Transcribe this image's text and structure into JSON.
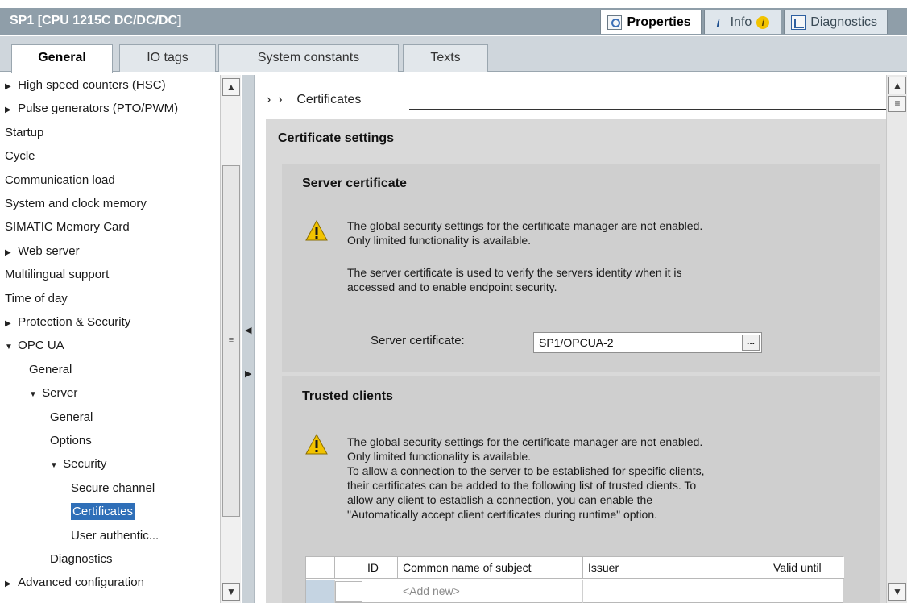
{
  "window": {
    "title": "SP1 [CPU 1215C DC/DC/DC]",
    "tabs": [
      {
        "label": "Properties",
        "icon": "magnifier-icon",
        "active": true
      },
      {
        "label": "Info",
        "icon": "info-icon",
        "badge": "i",
        "active": false
      },
      {
        "label": "Diagnostics",
        "icon": "diagnostics-icon",
        "active": false
      }
    ]
  },
  "subtabs": [
    {
      "label": "General",
      "active": true
    },
    {
      "label": "IO tags",
      "active": false
    },
    {
      "label": "System constants",
      "active": false
    },
    {
      "label": "Texts",
      "active": false
    }
  ],
  "tree": [
    {
      "label": "High speed counters (HSC)",
      "expander": "collapsed",
      "level": 0
    },
    {
      "label": "Pulse generators (PTO/PWM)",
      "expander": "collapsed",
      "level": 0
    },
    {
      "label": "Startup",
      "expander": "none",
      "level": 0
    },
    {
      "label": "Cycle",
      "expander": "none",
      "level": 0
    },
    {
      "label": "Communication load",
      "expander": "none",
      "level": 0
    },
    {
      "label": "System and clock memory",
      "expander": "none",
      "level": 0
    },
    {
      "label": "SIMATIC Memory Card",
      "expander": "none",
      "level": 0
    },
    {
      "label": "Web server",
      "expander": "collapsed",
      "level": 0
    },
    {
      "label": "Multilingual support",
      "expander": "none",
      "level": 0
    },
    {
      "label": "Time of day",
      "expander": "none",
      "level": 0
    },
    {
      "label": "Protection & Security",
      "expander": "collapsed",
      "level": 0
    },
    {
      "label": "OPC UA",
      "expander": "expanded",
      "level": 0
    },
    {
      "label": "General",
      "expander": "none",
      "level": 1
    },
    {
      "label": "Server",
      "expander": "expanded",
      "level": 1
    },
    {
      "label": "General",
      "expander": "none",
      "level": 2
    },
    {
      "label": "Options",
      "expander": "none",
      "level": 2
    },
    {
      "label": "Security",
      "expander": "expanded",
      "level": 2
    },
    {
      "label": "Secure channel",
      "expander": "none",
      "level": 3
    },
    {
      "label": "Certificates",
      "expander": "none",
      "level": 3,
      "selected": true
    },
    {
      "label": "User authentic...",
      "expander": "none",
      "level": 3
    },
    {
      "label": "Diagnostics",
      "expander": "none",
      "level": 2
    },
    {
      "label": "Advanced configuration",
      "expander": "collapsed",
      "level": 0
    }
  ],
  "main": {
    "breadcrumb": "Certificates",
    "section_title": "Certificate settings",
    "server_certificate": {
      "title": "Server certificate",
      "warning_line1": "The global security settings for the certificate manager are not enabled.",
      "warning_line2": "Only limited functionality is available.",
      "desc_line1": "The server certificate is used to verify the servers identity when it is",
      "desc_line2": "accessed and to enable endpoint security.",
      "field_label": "Server certificate:",
      "field_value": "SP1/OPCUA-2",
      "browse_label": "..."
    },
    "trusted_clients": {
      "title": "Trusted clients",
      "warning_line1": "The global security settings for the certificate manager are not enabled.",
      "warning_line2": "Only limited functionality is available.",
      "desc_lines": [
        "To allow a connection to the server to be established for specific clients,",
        "their certificates can be added to the following list of trusted clients. To",
        "allow any client to establish a connection, you can enable the",
        "\"Automatically accept client certificates during runtime\" option."
      ],
      "table": {
        "columns": [
          "",
          "",
          "ID",
          "Common name of subject",
          "Issuer",
          "Valid until"
        ],
        "add_row": "<Add new>"
      }
    }
  },
  "colors": {
    "titlebar": "#8f9ea9",
    "selection": "#2f6fb8",
    "panel_outer": "#d9d9d9",
    "panel_inner": "#cfcfcf",
    "warning": "#f2c300"
  }
}
